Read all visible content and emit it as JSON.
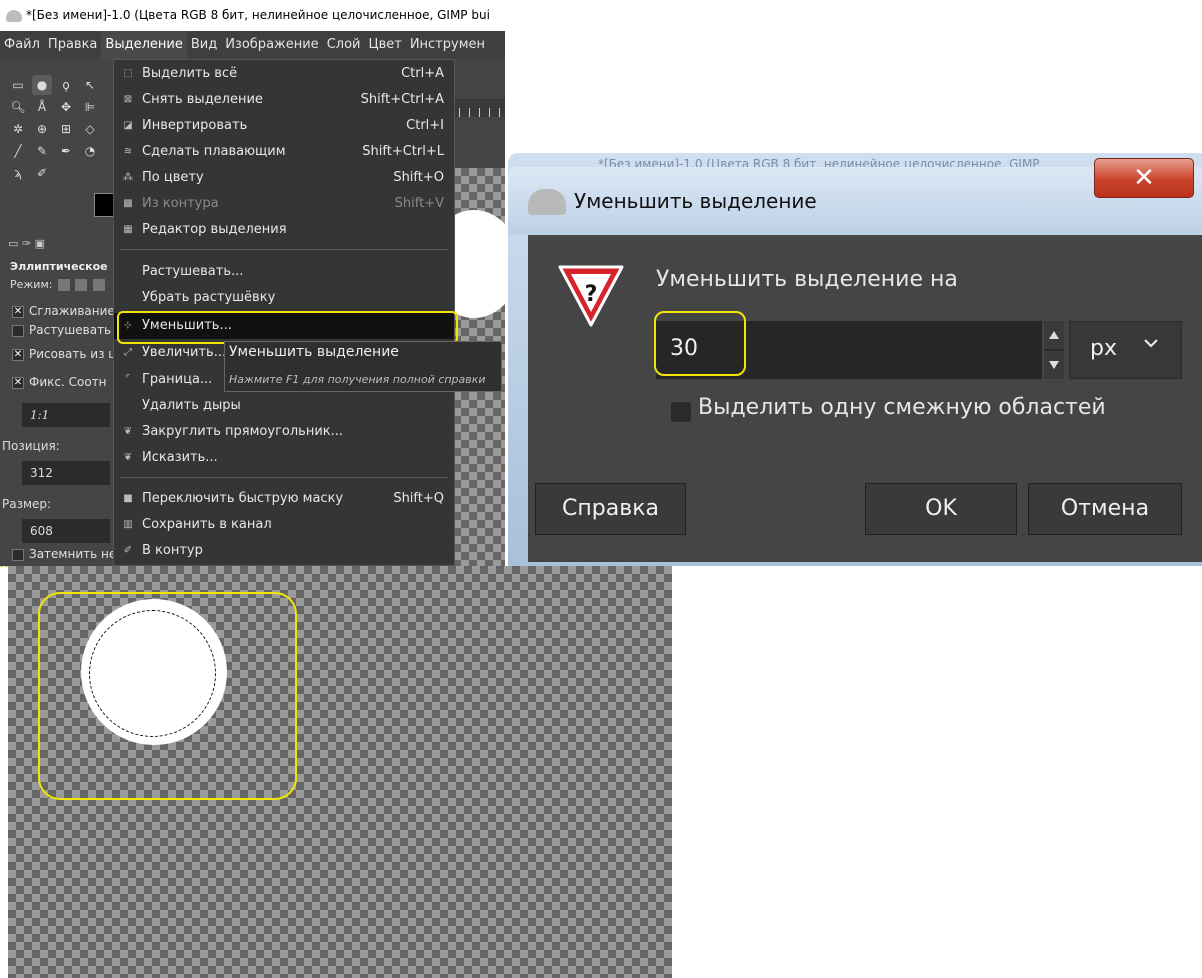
{
  "window": {
    "title": "*[Без имени]-1.0 (Цвета RGB 8 бит, нелинейное целочисленное, GIMP bui"
  },
  "menubar": {
    "items": [
      "Файл",
      "Правка",
      "Выделение",
      "Вид",
      "Изображение",
      "Слой",
      "Цвет",
      "Инструмен"
    ]
  },
  "tool_options": {
    "title": "Эллиптическое",
    "mode_label": "Режим:",
    "antialias_label": "Сглаживание",
    "feather_label": "Растушевать",
    "draw_from_center_label": "Рисовать из ц",
    "fixed_label": "Фикс. Соотн",
    "ratio_value": "1:1",
    "position_label": "Позиция:",
    "position_value": "312",
    "size_label": "Размер:",
    "size_value": "608",
    "darken_label": "Затемнить не"
  },
  "select_menu": {
    "items": [
      {
        "label": "Выделить всё",
        "accel": "Ctrl+A"
      },
      {
        "label": "Снять выделение",
        "accel": "Shift+Ctrl+A"
      },
      {
        "label": "Инвертировать",
        "accel": "Ctrl+I"
      },
      {
        "label": "Сделать плавающим",
        "accel": "Shift+Ctrl+L"
      },
      {
        "label": "По цвету",
        "accel": "Shift+O"
      },
      {
        "label": "Из контура",
        "accel": "Shift+V"
      },
      {
        "label": "Редактор выделения",
        "accel": ""
      },
      {
        "label": "Растушевать...",
        "accel": ""
      },
      {
        "label": "Убрать растушёвку",
        "accel": ""
      },
      {
        "label": "Уменьшить...",
        "accel": ""
      },
      {
        "label": "Увеличить...",
        "accel": ""
      },
      {
        "label": "Граница...",
        "accel": ""
      },
      {
        "label": "Удалить дыры",
        "accel": ""
      },
      {
        "label": "Закруглить прямоугольник...",
        "accel": ""
      },
      {
        "label": "Исказить...",
        "accel": ""
      },
      {
        "label": "Переключить быструю маску",
        "accel": "Shift+Q"
      },
      {
        "label": "Сохранить в канал",
        "accel": ""
      },
      {
        "label": "В контур",
        "accel": ""
      }
    ]
  },
  "tooltip": {
    "title": "Уменьшить выделение",
    "hint": "Нажмите F1 для получения полной справки"
  },
  "dialog": {
    "background_title": "*[Без имени]-1.0 (Цвета RGB 8 бит, нелинейное целочисленное, GIMP",
    "title": "Уменьшить выделение",
    "prompt": "Уменьшить выделение на",
    "value": "30",
    "unit": "px",
    "checkbox_label": "Выделить одну смежную областей",
    "help_button": "Справка",
    "ok_button": "OK",
    "cancel_button": "Отмена"
  }
}
